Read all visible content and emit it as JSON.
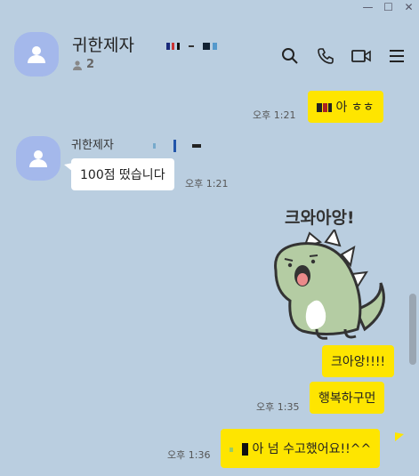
{
  "window": {
    "minimize": "—",
    "maximize": "☐",
    "close": "✕"
  },
  "header": {
    "title": "귀한제자",
    "member_count": "2"
  },
  "messages": {
    "m1_text": "아 ㅎㅎ",
    "m1_time": "오후 1:21",
    "sender": "귀한제자",
    "m2_text": "100점 떴습니다",
    "m2_time": "오후 1:21",
    "sticker_text": "크와아앙!",
    "m3_text": "크아앙!!!!",
    "m4_text": "행복하구먼",
    "m4_time": "오후 1:35",
    "m5_text": "아 넘 수고했어요!!^^",
    "m5_time": "오후 1:36"
  },
  "colors": {
    "bg": "#bacee0",
    "my_bubble": "#fee500",
    "their_bubble": "#ffffff",
    "avatar": "#a4b8eb"
  },
  "icons": [
    "search-icon",
    "phone-icon",
    "video-icon",
    "menu-icon",
    "person-icon"
  ]
}
